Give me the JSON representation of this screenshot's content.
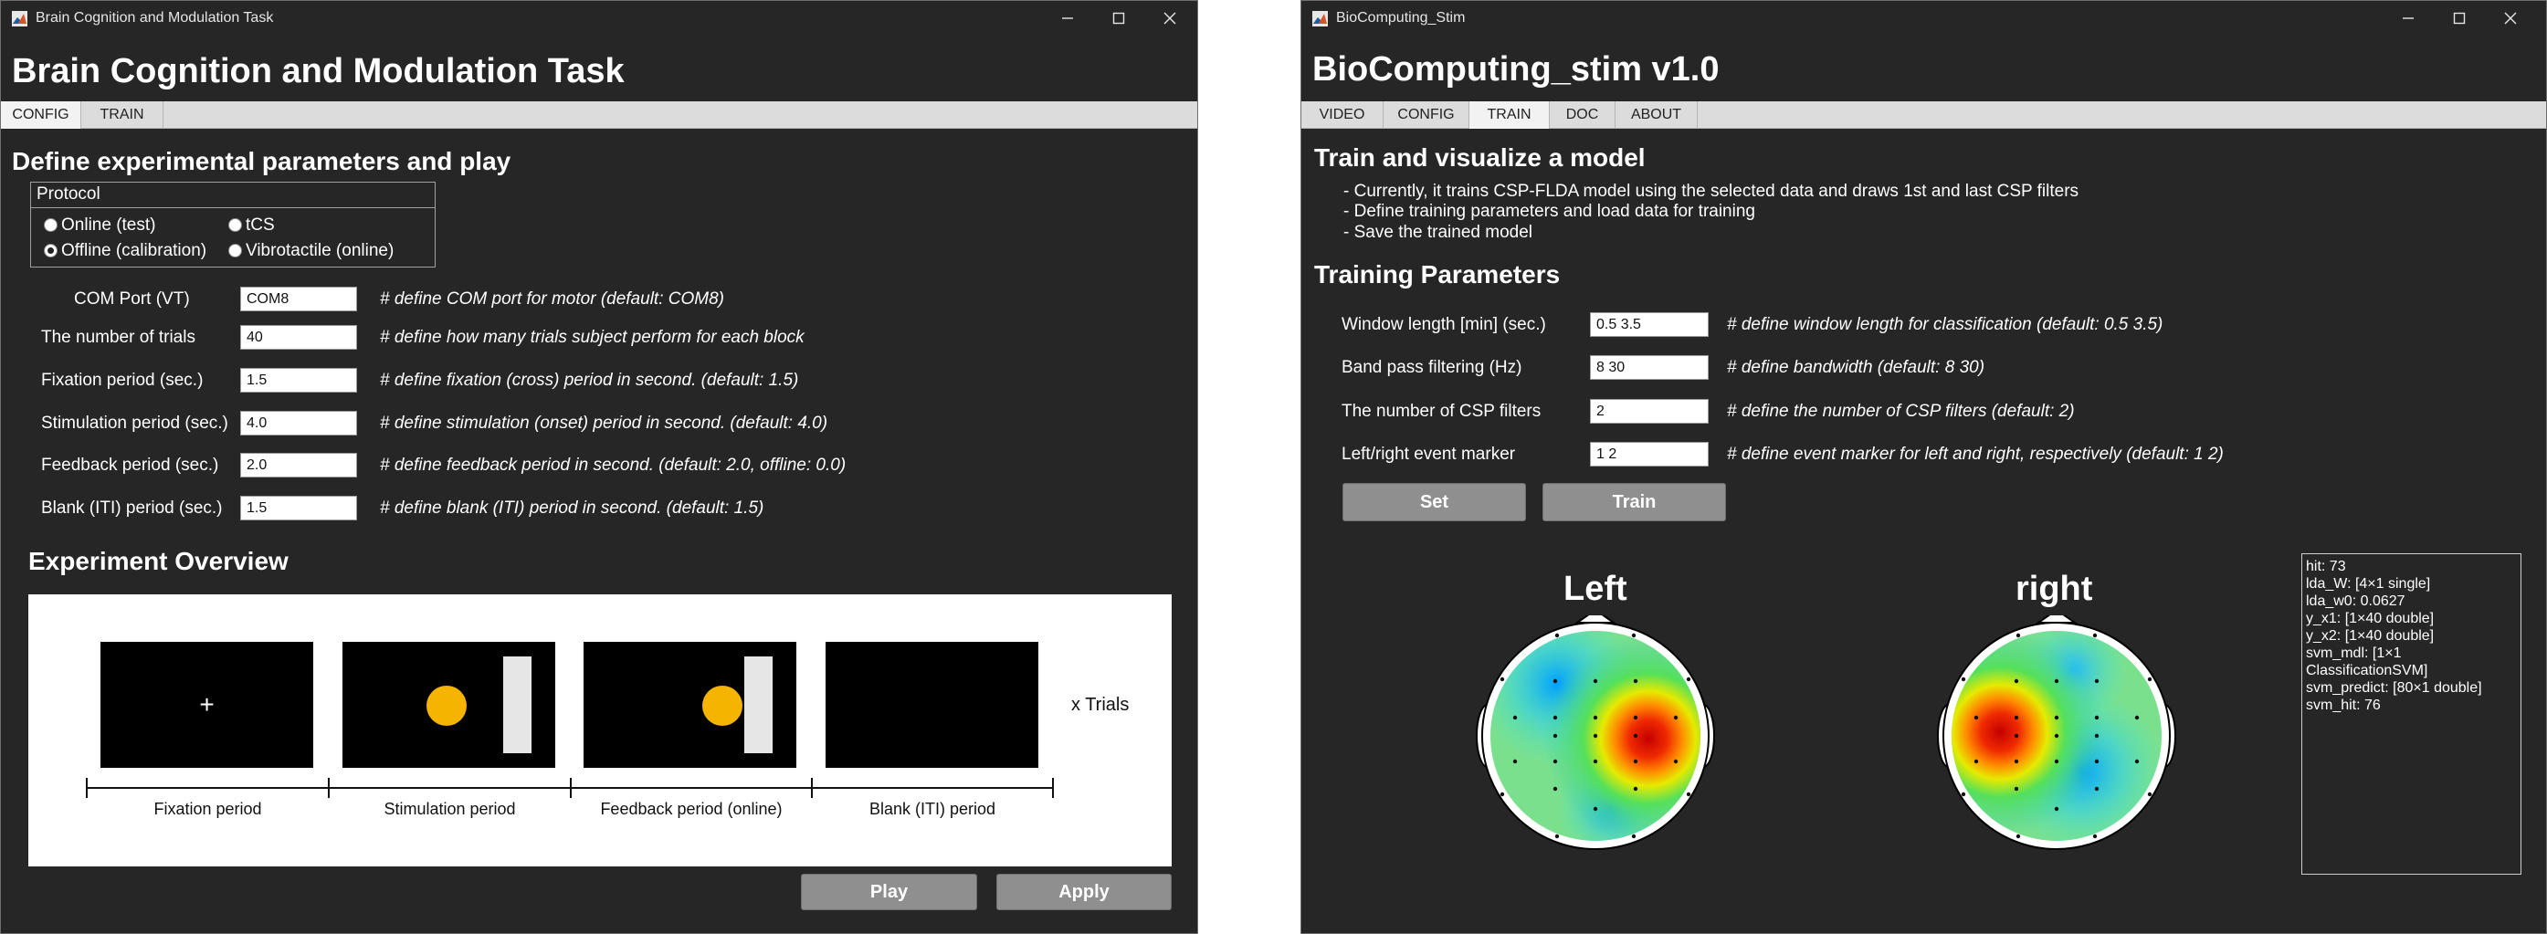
{
  "colors": {
    "window_bg": "#262626",
    "button_bg": "#8f8f8f",
    "tab_bar": "#dcdcdc",
    "marker_yellow": "#f5b400"
  },
  "left_window": {
    "window_title": "Brain Cognition and Modulation Task",
    "app_title": "Brain Cognition and Modulation Task",
    "tabs": [
      {
        "label": "CONFIG",
        "active": true
      },
      {
        "label": "TRAIN",
        "active": false
      }
    ],
    "section_title": "Define experimental parameters and play",
    "protocol": {
      "title": "Protocol",
      "options": [
        {
          "label": "Online (test)",
          "selected": false
        },
        {
          "label": "tCS",
          "selected": false
        },
        {
          "label": "Offline (calibration)",
          "selected": true
        },
        {
          "label": "Vibrotactile (online)",
          "selected": false
        }
      ]
    },
    "params": [
      {
        "label": "COM Port (VT)",
        "value": "COM8",
        "comment": "# define COM port for motor (default: COM8)"
      },
      {
        "label": "The number of trials",
        "value": "40",
        "comment": "# define how many trials subject perform for each block"
      },
      {
        "label": "Fixation period (sec.)",
        "value": "1.5",
        "comment": "# define fixation (cross) period in second. (default: 1.5)"
      },
      {
        "label": "Stimulation period (sec.)",
        "value": "4.0",
        "comment": "# define stimulation (onset) period in second. (default: 4.0)"
      },
      {
        "label": "Feedback period (sec.)",
        "value": "2.0",
        "comment": "# define feedback period in second. (default: 2.0, offline: 0.0)"
      },
      {
        "label": "Blank (ITI) period (sec.)",
        "value": "1.5",
        "comment": "# define blank (ITI) period in second. (default: 1.5)"
      }
    ],
    "overview": {
      "title": "Experiment Overview",
      "fixation_symbol": "+",
      "repeat_label": "x Trials",
      "period_labels": [
        "Fixation period",
        "Stimulation period",
        "Feedback period (online)",
        "Blank (ITI) period"
      ]
    },
    "buttons": {
      "play": "Play",
      "apply": "Apply"
    }
  },
  "right_window": {
    "window_title": "BioComputing_Stim",
    "app_title": "BioComputing_stim v1.0",
    "tabs": [
      {
        "label": "VIDEO",
        "active": false
      },
      {
        "label": "CONFIG",
        "active": false
      },
      {
        "label": "TRAIN",
        "active": true
      },
      {
        "label": "DOC",
        "active": false
      },
      {
        "label": "ABOUT",
        "active": false
      }
    ],
    "section_title": "Train and visualize a model",
    "description": [
      "- Currently, it trains CSP-FLDA model using the selected data and draws 1st and last CSP filters",
      "- Define training parameters and load data for training",
      "- Save the trained model"
    ],
    "params_title": "Training Parameters",
    "params": [
      {
        "label": "Window length [min] (sec.)",
        "value": "0.5 3.5",
        "comment": "# define window length for classification (default: 0.5 3.5)"
      },
      {
        "label": "Band pass filtering (Hz)",
        "value": "8 30",
        "comment": "# define bandwidth (default: 8 30)"
      },
      {
        "label": "The number of CSP filters",
        "value": "2",
        "comment": "# define the number of CSP filters (default: 2)"
      },
      {
        "label": "Left/right event marker",
        "value": "1 2",
        "comment": "# define event marker for left and right, respectively (default: 1 2)"
      }
    ],
    "buttons": {
      "set": "Set",
      "train": "Train"
    },
    "topomaps": [
      {
        "label": "Left"
      },
      {
        "label": "right"
      }
    ],
    "info_lines": [
      "hit: 73",
      "lda_W: [4×1 single]",
      "lda_w0: 0.0627",
      "y_x1: [1×40 double]",
      "y_x2: [1×40 double]",
      "svm_mdl: [1×1",
      "ClassificationSVM]",
      "svm_predict: [80×1 double]",
      "svm_hit: 76"
    ]
  }
}
